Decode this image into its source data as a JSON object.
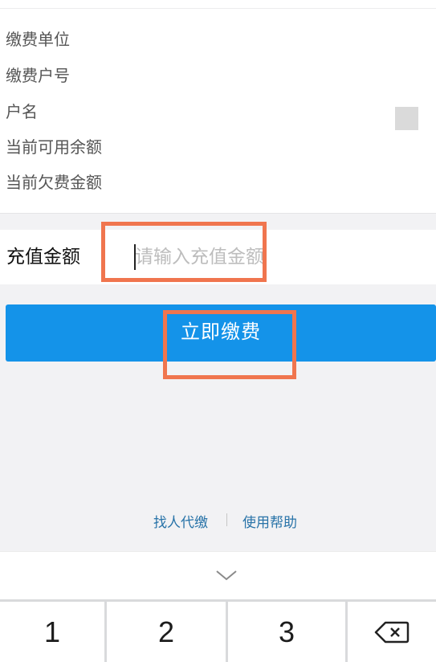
{
  "info": {
    "rows": [
      {
        "label": "缴费单位",
        "value": ""
      },
      {
        "label": "缴费户号",
        "value": ""
      },
      {
        "label": "户名",
        "value": ""
      },
      {
        "label": "当前可用余额",
        "value": ""
      },
      {
        "label": "当前欠费金额",
        "value": ""
      }
    ]
  },
  "recharge": {
    "label": "充值金额",
    "input_value": "",
    "placeholder": "请输入充值金额"
  },
  "pay_button": {
    "label": "立即缴费"
  },
  "footer_links": {
    "proxy_pay": "找人代缴",
    "help": "使用帮助"
  },
  "keyboard": {
    "keys": [
      "1",
      "2",
      "3"
    ],
    "delete_icon": "backspace-icon",
    "collapse_icon": "chevron-down-icon"
  },
  "colors": {
    "accent": "#1493e9",
    "highlight": "#f0754e",
    "link": "#2873a8"
  }
}
